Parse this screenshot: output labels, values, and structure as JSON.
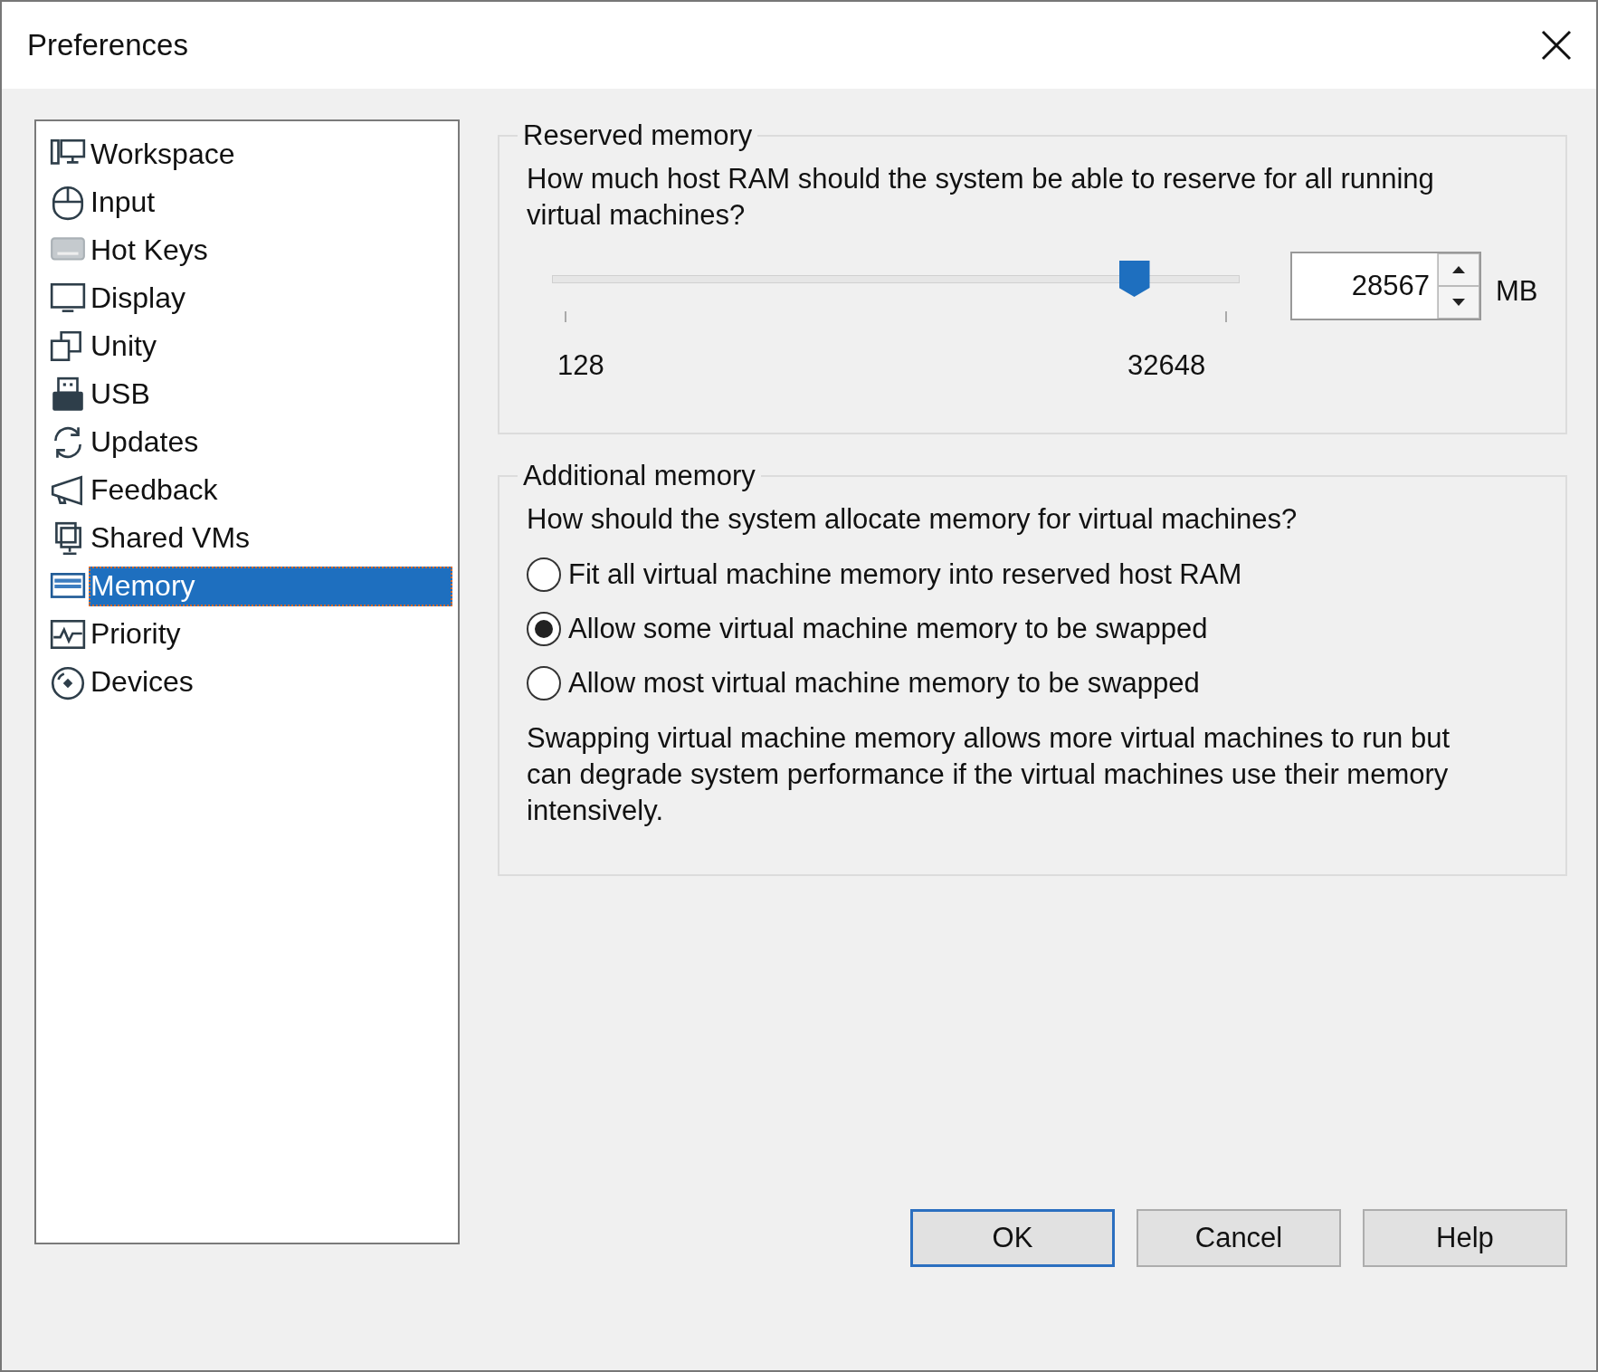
{
  "window": {
    "title": "Preferences"
  },
  "sidebar": {
    "items": [
      {
        "label": "Workspace",
        "kind": "workspace",
        "selected": false
      },
      {
        "label": "Input",
        "kind": "mouse",
        "selected": false
      },
      {
        "label": "Hot Keys",
        "kind": "keyboard",
        "selected": false
      },
      {
        "label": "Display",
        "kind": "monitor",
        "selected": false
      },
      {
        "label": "Unity",
        "kind": "windows",
        "selected": false
      },
      {
        "label": "USB",
        "kind": "usb",
        "selected": false
      },
      {
        "label": "Updates",
        "kind": "refresh",
        "selected": false
      },
      {
        "label": "Feedback",
        "kind": "megaphone",
        "selected": false
      },
      {
        "label": "Shared VMs",
        "kind": "shared",
        "selected": false
      },
      {
        "label": "Memory",
        "kind": "memory",
        "selected": true
      },
      {
        "label": "Priority",
        "kind": "pulse",
        "selected": false
      },
      {
        "label": "Devices",
        "kind": "disc",
        "selected": false
      }
    ]
  },
  "reserved_memory": {
    "title": "Reserved memory",
    "question": "How much host RAM should the system be able to reserve for all running virtual machines?",
    "slider": {
      "level": 0.86,
      "min_label": "128",
      "max_label": "32648"
    },
    "spin": {
      "value": "28567",
      "unit": "MB"
    }
  },
  "additional_memory": {
    "title": "Additional memory",
    "question": "How should the system allocate memory for virtual machines?",
    "options": [
      {
        "label": "Fit all virtual machine memory into reserved host RAM",
        "selected": false
      },
      {
        "label": "Allow some virtual machine memory to be swapped",
        "selected": true
      },
      {
        "label": "Allow most virtual machine memory to be swapped",
        "selected": false
      }
    ],
    "note": "Swapping virtual machine memory allows more virtual machines to run but can degrade system performance if the virtual machines use their memory intensively."
  },
  "buttons": [
    {
      "label": "OK",
      "default": true
    },
    {
      "label": "Cancel",
      "default": false
    },
    {
      "label": "Help",
      "default": false
    }
  ]
}
